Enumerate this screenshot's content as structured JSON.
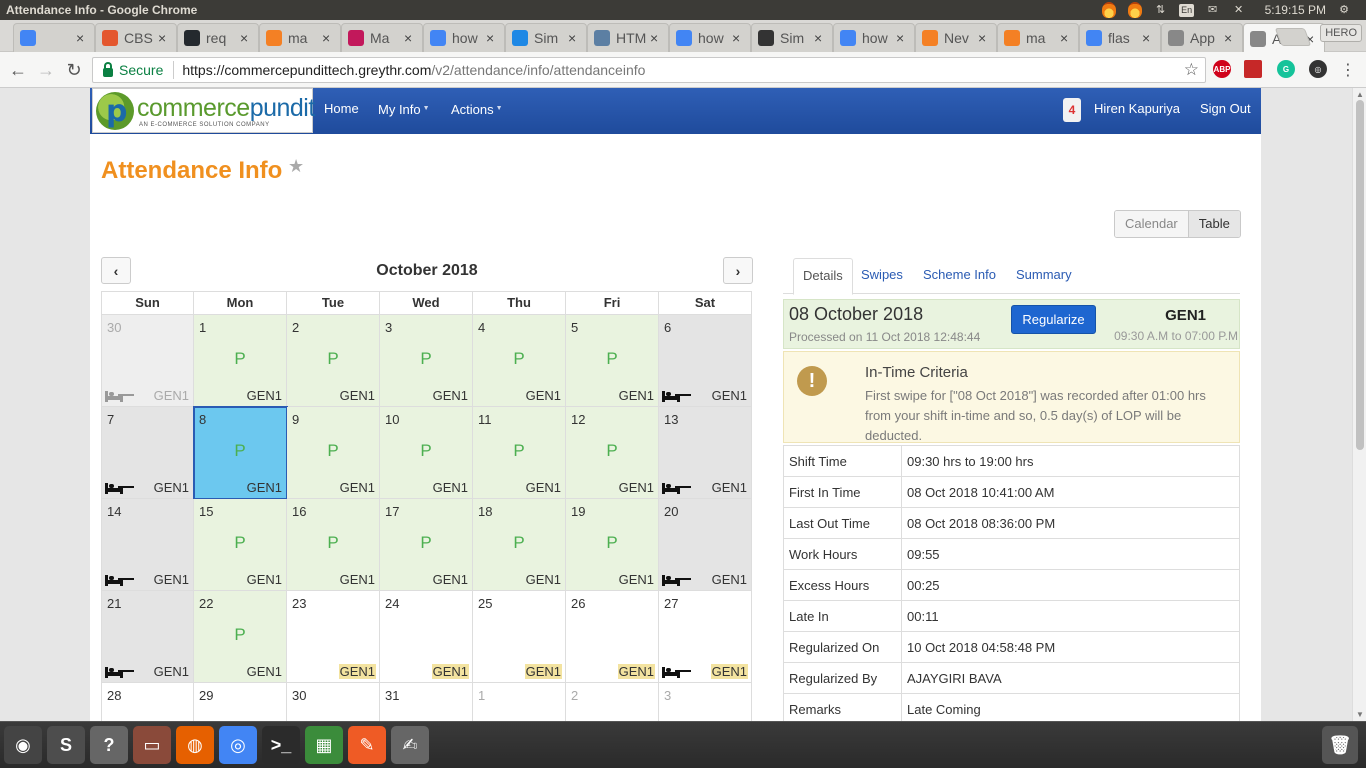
{
  "window": {
    "title": "Attendance Info - Google Chrome",
    "clock": "5:19:15 PM",
    "keyboard": "En",
    "user": "HERO"
  },
  "tabs": [
    {
      "label": "",
      "icon": "google-translate-icon",
      "color": "#4285f4"
    },
    {
      "label": "CBS",
      "icon": "cb-icon",
      "color": "#e4572e"
    },
    {
      "label": "req",
      "icon": "github-icon",
      "color": "#24292e"
    },
    {
      "label": "ma",
      "icon": "stackoverflow-icon",
      "color": "#f48024"
    },
    {
      "label": "Ma",
      "icon": "globe-icon",
      "color": "#c2185b"
    },
    {
      "label": "how",
      "icon": "google-icon",
      "color": "#4285f4"
    },
    {
      "label": "Sim",
      "icon": "cube-icon",
      "color": "#1e88e5"
    },
    {
      "label": "HTM",
      "icon": "grid-icon",
      "color": "#5c7fa3"
    },
    {
      "label": "how",
      "icon": "google-icon",
      "color": "#4285f4"
    },
    {
      "label": "Sim",
      "icon": "circle-icon",
      "color": "#333333"
    },
    {
      "label": "how",
      "icon": "google-icon",
      "color": "#4285f4"
    },
    {
      "label": "Nev",
      "icon": "stackoverflow-icon",
      "color": "#f48024"
    },
    {
      "label": "ma",
      "icon": "stackoverflow-icon",
      "color": "#f48024"
    },
    {
      "label": "flas",
      "icon": "google-icon",
      "color": "#4285f4"
    },
    {
      "label": "App",
      "icon": "document-icon",
      "color": "#888888"
    },
    {
      "label": "Att",
      "icon": "document-icon",
      "color": "#888888",
      "active": true
    }
  ],
  "omnibox": {
    "secure_label": "Secure",
    "url_host": "https://commercepundittech.greythr.com",
    "url_path": "/v2/attendance/info/attendanceinfo"
  },
  "nav": {
    "brand": "commercepundit",
    "brand_a": "commerce",
    "brand_b": "pundit",
    "brand_tagline": "AN E-COMMERCE SOLUTION COMPANY",
    "home": "Home",
    "my_info": "My Info",
    "actions": "Actions",
    "notif_count": "4",
    "user_name": "Hiren Kapuriya",
    "sign_out": "Sign Out"
  },
  "page": {
    "title": "Attendance Info",
    "view_calendar": "Calendar",
    "view_table": "Table"
  },
  "calendar": {
    "month": "October 2018",
    "weekdays": [
      "Sun",
      "Mon",
      "Tue",
      "Wed",
      "Thu",
      "Fri",
      "Sat"
    ],
    "weeks": [
      [
        {
          "d": "30",
          "t": "other",
          "shift": "GEN1",
          "bed": true
        },
        {
          "d": "1",
          "t": "present",
          "m": "P",
          "shift": "GEN1"
        },
        {
          "d": "2",
          "t": "present",
          "m": "P",
          "shift": "GEN1"
        },
        {
          "d": "3",
          "t": "present",
          "m": "P",
          "shift": "GEN1"
        },
        {
          "d": "4",
          "t": "present",
          "m": "P",
          "shift": "GEN1"
        },
        {
          "d": "5",
          "t": "present",
          "m": "P",
          "shift": "GEN1"
        },
        {
          "d": "6",
          "t": "off",
          "shift": "GEN1",
          "bed": true
        }
      ],
      [
        {
          "d": "7",
          "t": "off",
          "shift": "GEN1",
          "bed": true
        },
        {
          "d": "8",
          "t": "sel",
          "m": "P",
          "shift": "GEN1"
        },
        {
          "d": "9",
          "t": "present",
          "m": "P",
          "shift": "GEN1"
        },
        {
          "d": "10",
          "t": "present",
          "m": "P",
          "shift": "GEN1"
        },
        {
          "d": "11",
          "t": "present",
          "m": "P",
          "shift": "GEN1"
        },
        {
          "d": "12",
          "t": "present",
          "m": "P",
          "shift": "GEN1"
        },
        {
          "d": "13",
          "t": "off",
          "shift": "GEN1",
          "bed": true
        }
      ],
      [
        {
          "d": "14",
          "t": "off",
          "shift": "GEN1",
          "bed": true
        },
        {
          "d": "15",
          "t": "present",
          "m": "P",
          "shift": "GEN1"
        },
        {
          "d": "16",
          "t": "present",
          "m": "P",
          "shift": "GEN1"
        },
        {
          "d": "17",
          "t": "present",
          "m": "P",
          "shift": "GEN1"
        },
        {
          "d": "18",
          "t": "present",
          "m": "P",
          "shift": "GEN1"
        },
        {
          "d": "19",
          "t": "present",
          "m": "P",
          "shift": "GEN1"
        },
        {
          "d": "20",
          "t": "off",
          "shift": "GEN1",
          "bed": true
        }
      ],
      [
        {
          "d": "21",
          "t": "off",
          "shift": "GEN1",
          "bed": true
        },
        {
          "d": "22",
          "t": "present",
          "m": "P",
          "shift": "GEN1"
        },
        {
          "d": "23",
          "t": "future",
          "shift": "GEN1",
          "hl": true
        },
        {
          "d": "24",
          "t": "future",
          "shift": "GEN1",
          "hl": true
        },
        {
          "d": "25",
          "t": "future",
          "shift": "GEN1",
          "hl": true
        },
        {
          "d": "26",
          "t": "future",
          "shift": "GEN1",
          "hl": true
        },
        {
          "d": "27",
          "t": "future",
          "shift": "GEN1",
          "hl": true,
          "bed": true
        }
      ],
      [
        {
          "d": "28",
          "t": "future"
        },
        {
          "d": "29",
          "t": "future"
        },
        {
          "d": "30",
          "t": "future"
        },
        {
          "d": "31",
          "t": "future"
        },
        {
          "d": "1",
          "t": "faded"
        },
        {
          "d": "2",
          "t": "faded"
        },
        {
          "d": "3",
          "t": "faded"
        }
      ]
    ]
  },
  "details": {
    "tabs": [
      "Details",
      "Swipes",
      "Scheme Info",
      "Summary"
    ],
    "date": "08 October 2018",
    "processed": "Processed on 11 Oct 2018 12:48:44",
    "regularize": "Regularize",
    "shift": "GEN1",
    "shift_time": "09:30 A.M to 07:00 P.M",
    "alert_title": "In-Time Criteria",
    "alert_text": "First swipe for [\"08 Oct 2018\"] was recorded after 01:00 hrs from your shift in-time and so, 0.5 day(s) of LOP will be deducted.",
    "rows": [
      {
        "k": "Shift Time",
        "v": "09:30 hrs to 19:00 hrs"
      },
      {
        "k": "First In Time",
        "v": "08 Oct 2018 10:41:00 AM"
      },
      {
        "k": "Last Out Time",
        "v": "08 Oct 2018 08:36:00 PM"
      },
      {
        "k": "Work Hours",
        "v": "09:55"
      },
      {
        "k": "Excess Hours",
        "v": "00:25"
      },
      {
        "k": "Late In",
        "v": "00:11"
      },
      {
        "k": "Regularized On",
        "v": "10 Oct 2018 04:58:48 PM"
      },
      {
        "k": "Regularized By",
        "v": "AJAYGIRI BAVA"
      },
      {
        "k": "Remarks",
        "v": "Late Coming"
      }
    ]
  },
  "dock": [
    {
      "icon": "ubuntu-dash-icon",
      "color": "#444444"
    },
    {
      "icon": "sublime-text-icon",
      "color": "#4d4d4d"
    },
    {
      "icon": "help-icon",
      "color": "#666666"
    },
    {
      "icon": "file-manager-icon",
      "color": "#8a4a3a"
    },
    {
      "icon": "firefox-icon",
      "color": "#e66000"
    },
    {
      "icon": "chrome-icon",
      "color": "#4285f4"
    },
    {
      "icon": "terminal-icon",
      "color": "#2b2b2b"
    },
    {
      "icon": "spreadsheet-icon",
      "color": "#3b8c3b"
    },
    {
      "icon": "postman-icon",
      "color": "#ef5b25"
    },
    {
      "icon": "text-editor-icon",
      "color": "#666666"
    }
  ]
}
